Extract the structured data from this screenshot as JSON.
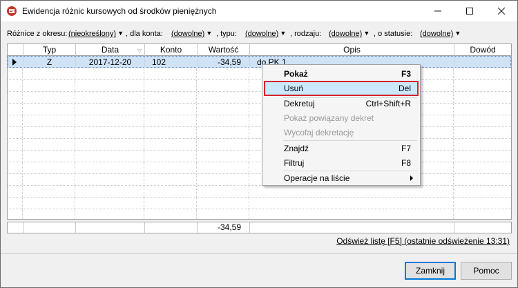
{
  "window": {
    "title": "Ewidencja różnic kursowych od środków pieniężnych",
    "minimize": "—",
    "maximize": "☐",
    "close": "✕"
  },
  "filters": {
    "period_label": "Różnice z okresu:",
    "period_value": "(nieokreślony)",
    "account_label": ", dla konta:",
    "account_value": "(dowolne)",
    "type_label": ", typu:",
    "type_value": "(dowolne)",
    "kind_label": ", rodzaju:",
    "kind_value": "(dowolne)",
    "status_label": ", o statusie:",
    "status_value": "(dowolne)",
    "dropdown_arrow": "▼"
  },
  "grid": {
    "columns": [
      "Typ",
      "Data",
      "Konto",
      "Wartość",
      "Opis",
      "Dowód"
    ],
    "rows": [
      {
        "typ": "Z",
        "data": "2017-12-20",
        "konto": "102",
        "wartosc": "-34,59",
        "opis": "do PK 1",
        "dowod": ""
      }
    ],
    "footer_total": "-34,59"
  },
  "refresh_link": "Odśwież listę [F5] (ostatnie odświeżenie 13:31)",
  "buttons": {
    "close": "Zamknij",
    "help": "Pomoc"
  },
  "context_menu": {
    "items": [
      {
        "label": "Pokaż",
        "shortcut": "F3"
      },
      {
        "label": "Usuń",
        "shortcut": "Del"
      },
      {
        "label": "Dekretuj",
        "shortcut": "Ctrl+Shift+R"
      },
      {
        "label": "Pokaż powiązany dekret",
        "shortcut": ""
      },
      {
        "label": "Wycofaj dekretację",
        "shortcut": ""
      },
      {
        "label": "Znajdź",
        "shortcut": "F7"
      },
      {
        "label": "Filtruj",
        "shortcut": "F8"
      },
      {
        "label": "Operacje na liście",
        "shortcut": ""
      }
    ]
  },
  "colors": {
    "selection": "#cfe2f6",
    "highlight_border": "#d2232a",
    "menu_hover": "#cce8ff",
    "app_icon": "#c0392b"
  }
}
